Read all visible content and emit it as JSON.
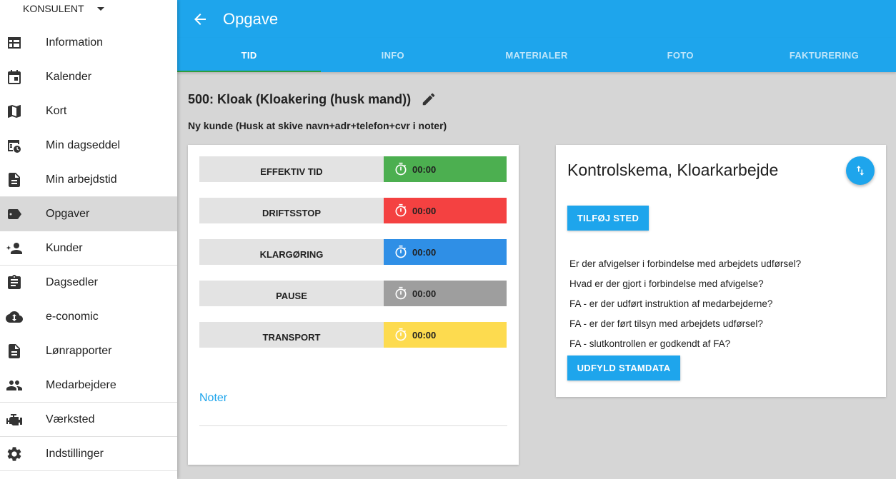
{
  "sidebar": {
    "user": "KONSULENT",
    "items": [
      {
        "label": "Information",
        "icon": "table-icon"
      },
      {
        "label": "Kalender",
        "icon": "calendar-icon"
      },
      {
        "label": "Kort",
        "icon": "map-icon"
      },
      {
        "label": "Min dagseddel",
        "icon": "schedule-icon"
      },
      {
        "label": "Min arbejdstid",
        "icon": "document-icon"
      },
      {
        "label": "Opgaver",
        "icon": "tags-icon"
      },
      {
        "label": "Kunder",
        "icon": "person-add-icon"
      },
      {
        "label": "Dagsedler",
        "icon": "clipboard-icon"
      },
      {
        "label": "e-conomic",
        "icon": "cloud-sync-icon"
      },
      {
        "label": "Lønrapporter",
        "icon": "document-icon"
      },
      {
        "label": "Medarbejdere",
        "icon": "people-icon"
      },
      {
        "label": "Værksted",
        "icon": "engine-icon"
      },
      {
        "label": "Indstillinger",
        "icon": "gear-icon"
      }
    ]
  },
  "appbar": {
    "title": "Opgave"
  },
  "tabs": [
    "TID",
    "INFO",
    "MATERIALER",
    "FOTO",
    "FAKTURERING"
  ],
  "task": {
    "title": "500: Kloak (Kloakering (husk mand))",
    "subtitle": "Ny kunde (Husk at skive navn+adr+telefon+cvr i noter)"
  },
  "timers": [
    {
      "label": "EFFEKTIV TID",
      "value": "00:00",
      "color": "#4caf50"
    },
    {
      "label": "DRIFTSSTOP",
      "value": "00:00",
      "color": "#f44141"
    },
    {
      "label": "KLARGØRING",
      "value": "00:00",
      "color": "#2f8fe6"
    },
    {
      "label": "PAUSE",
      "value": "00:00",
      "color": "#9e9e9e"
    },
    {
      "label": "TRANSPORT",
      "value": "00:00",
      "color": "#fddb4f"
    }
  ],
  "noter": "Noter",
  "kontrol": {
    "title": "Kontrolskema, Kloarkarbejde",
    "add_button": "TILFØJ STED",
    "questions": [
      "Er der afvigelser i forbindelse med arbejdets udførsel?",
      "Hvad er der gjort i forbindelse med afvigelse?",
      "FA - er der udført instruktion af medarbejderne?",
      "FA - er der ført tilsyn med arbejdets udførsel?",
      "FA - slutkontrollen er godkendt af FA?"
    ],
    "fill_button": "UDFYLD STAMDATA"
  },
  "colors": {
    "accent": "#1ea5ec"
  }
}
